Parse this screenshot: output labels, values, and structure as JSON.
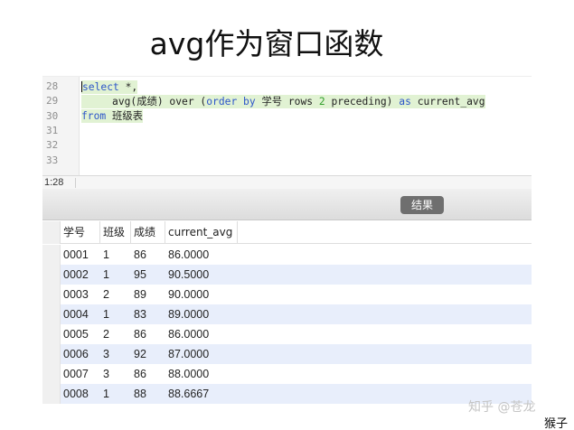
{
  "slide": {
    "title": "avg作为窗口函数"
  },
  "editor": {
    "line_numbers": [
      "28",
      "29",
      "30",
      "31",
      "32",
      "33"
    ],
    "line1": {
      "kw": "select",
      "rest": " *,"
    },
    "line2": {
      "indent": "     ",
      "func": "avg(成绩) over (",
      "kw1": "order by",
      "mid": " 学号 rows ",
      "num": "2",
      "mid2": " preceding) ",
      "kw2": "as",
      "tail": " current_avg"
    },
    "line3": {
      "kw": "from",
      "rest": " 班级表"
    }
  },
  "statusbar": {
    "position": "1:28"
  },
  "results": {
    "tab_label": "结果"
  },
  "table": {
    "columns": [
      "学号",
      "班级",
      "成绩",
      "current_avg"
    ],
    "rows": [
      [
        "0001",
        "1",
        "86",
        "86.0000"
      ],
      [
        "0002",
        "1",
        "95",
        "90.5000"
      ],
      [
        "0003",
        "2",
        "89",
        "90.0000"
      ],
      [
        "0004",
        "1",
        "83",
        "89.0000"
      ],
      [
        "0005",
        "2",
        "86",
        "86.0000"
      ],
      [
        "0006",
        "3",
        "92",
        "87.0000"
      ],
      [
        "0007",
        "3",
        "86",
        "88.0000"
      ],
      [
        "0008",
        "1",
        "88",
        "88.6667"
      ]
    ]
  },
  "watermark": {
    "text": "知乎 @苍龙",
    "author": "猴子"
  },
  "colors": {
    "keyword": "#2c55c9",
    "number": "#32a02c",
    "highlight": "#e1f2d3",
    "row_alt": "#e8eefb"
  }
}
